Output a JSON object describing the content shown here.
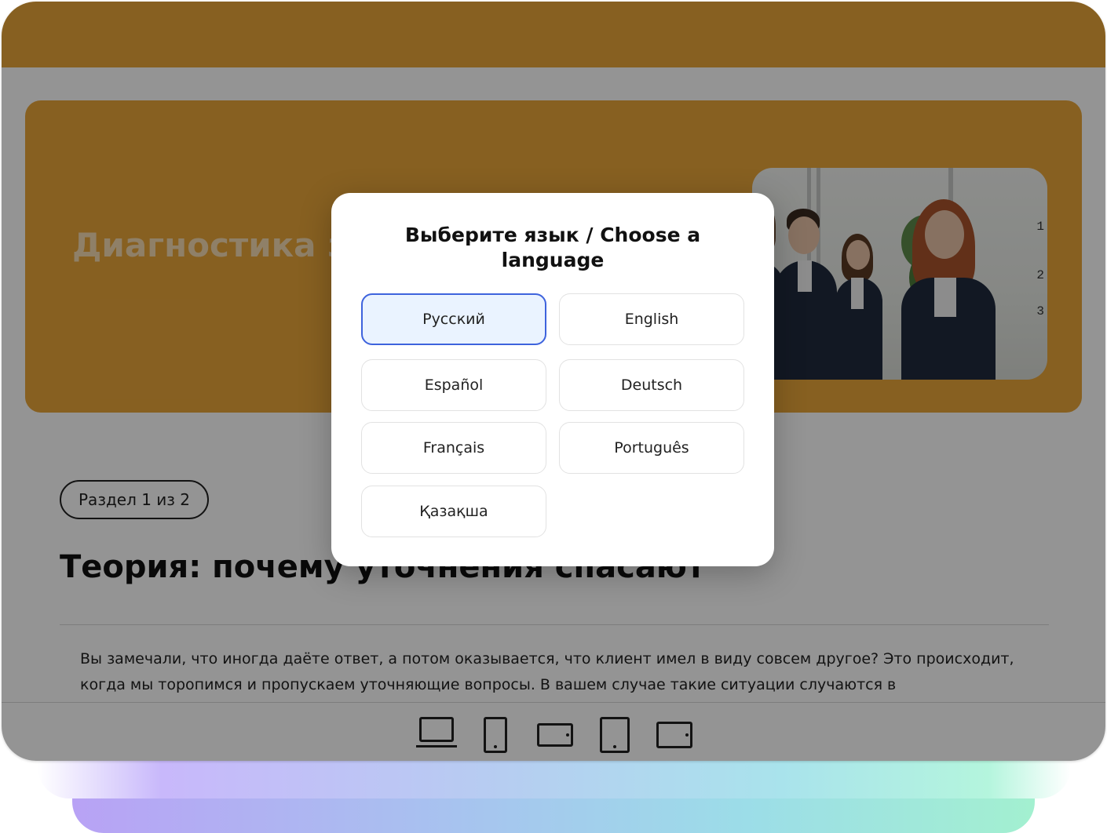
{
  "course": {
    "hero_title": "Диагностика з",
    "section_badge": "Раздел 1 из 2",
    "lesson_title": "Теория: почему уточнения спасают",
    "paragraph": "Вы замечали, что иногда даёте ответ, а потом оказывается, что клиент имел в виду совсем другое? Это происходит, когда мы торопимся и пропускаем уточняющие вопросы. В вашем случае такие ситуации случаются в",
    "photo_labels": [
      "1",
      "2",
      "3"
    ]
  },
  "language_modal": {
    "title": "Выберите язык / Choose a language",
    "selected": "Русский",
    "options": [
      "Русский",
      "English",
      "Español",
      "Deutsch",
      "Français",
      "Português",
      "Қазақша"
    ]
  },
  "device_preview": {
    "icons": [
      "laptop-icon",
      "phone-portrait-icon",
      "phone-landscape-icon",
      "tablet-portrait-icon",
      "tablet-landscape-icon"
    ]
  },
  "colors": {
    "brand_orange": "#e8a53a",
    "selected_border": "#3e63dd",
    "selected_fill": "#eaf3ff"
  }
}
